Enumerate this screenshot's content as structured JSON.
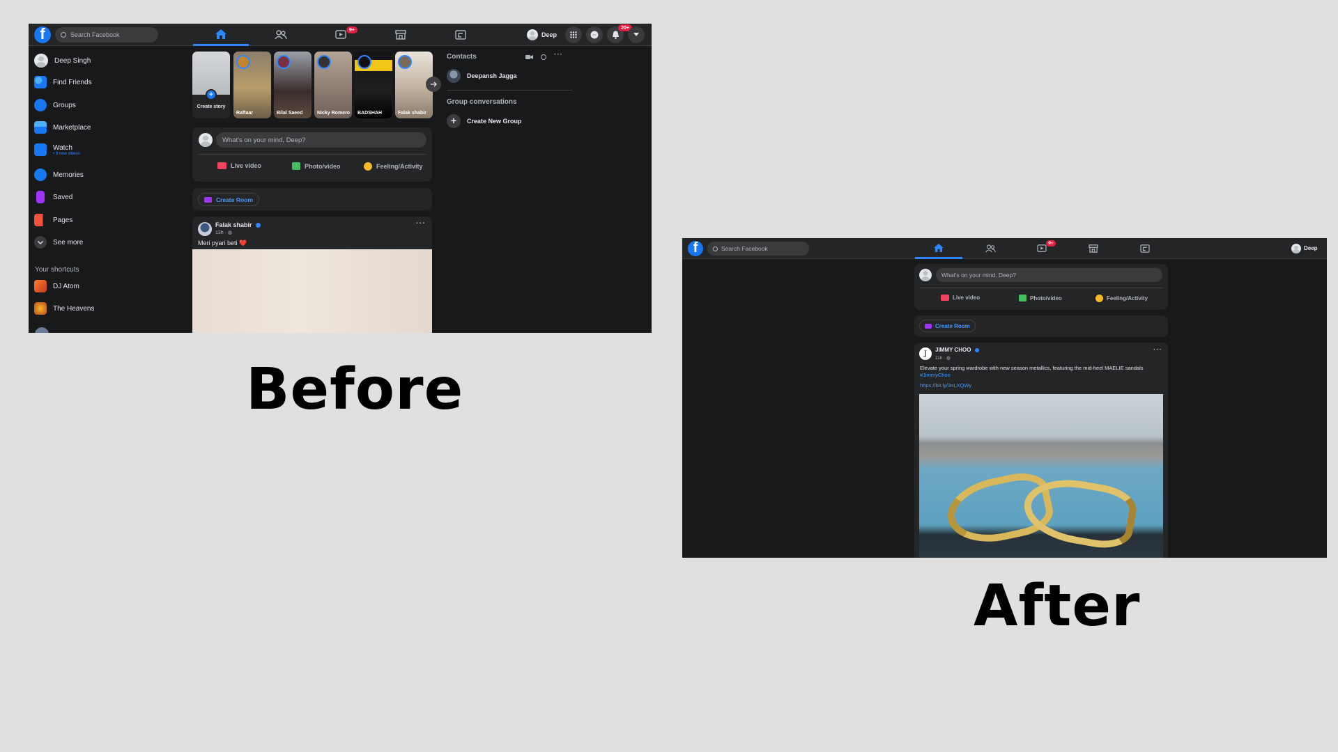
{
  "captions": {
    "before": "Before",
    "after": "After"
  },
  "colors": {
    "brand_blue": "#1877f2",
    "active_tab": "#2d88ff",
    "bg": "#18191a",
    "surface": "#242526",
    "badge_red": "#e41e3f",
    "link_blue": "#4599ff"
  },
  "before": {
    "search_placeholder": "Search Facebook",
    "profile_name": "Deep",
    "badges": {
      "watch": "9+",
      "notifications": "20+"
    },
    "sidebar": {
      "items": [
        {
          "label": "Deep Singh",
          "icon": "avatar"
        },
        {
          "label": "Find Friends",
          "icon": "friends-icon"
        },
        {
          "label": "Groups",
          "icon": "groups-icon"
        },
        {
          "label": "Marketplace",
          "icon": "marketplace-icon"
        },
        {
          "label": "Watch",
          "icon": "watch-icon",
          "sub": "• 9 new videos"
        },
        {
          "label": "Memories",
          "icon": "memories-icon"
        },
        {
          "label": "Saved",
          "icon": "saved-icon"
        },
        {
          "label": "Pages",
          "icon": "pages-icon"
        },
        {
          "label": "See more",
          "icon": "chevron-down-icon"
        }
      ],
      "shortcuts_title": "Your shortcuts",
      "shortcuts": [
        {
          "label": "DJ Atom"
        },
        {
          "label": "The Heavens"
        }
      ]
    },
    "stories": [
      {
        "name": "Create story"
      },
      {
        "name": "Raftaar"
      },
      {
        "name": "Bilal Saeed"
      },
      {
        "name": "Nicky Romero"
      },
      {
        "name": "BADSHAH"
      },
      {
        "name": "Falak shabir"
      }
    ],
    "composer": {
      "placeholder": "What's on your mind, Deep?",
      "live": "Live video",
      "photo": "Photo/video",
      "feeling": "Feeling/Activity"
    },
    "create_room": "Create Room",
    "post": {
      "author": "Falak shabir",
      "time": "13h · ",
      "text": "Meri pyari beti ❤️"
    },
    "contacts": {
      "title": "Contacts",
      "items": [
        {
          "name": "Deepansh Jagga"
        }
      ],
      "group_title": "Group conversations",
      "create_group": "Create New Group"
    }
  },
  "after": {
    "search_placeholder": "Search Facebook",
    "profile_name": "Deep",
    "badges": {
      "watch": "9+"
    },
    "composer": {
      "placeholder": "What's on your mind, Deep?",
      "live": "Live video",
      "photo": "Photo/video",
      "feeling": "Feeling/Activity"
    },
    "create_room": "Create Room",
    "post": {
      "author": "JIMMY CHOO",
      "time": "11h · ",
      "text": "Elevate your spring wardrobe with new season metallics, featuring the mid-heel MAELIE sandals",
      "hashtag": "#JimmyChoo",
      "link": "https://bit.ly/3nLXQWy"
    }
  }
}
